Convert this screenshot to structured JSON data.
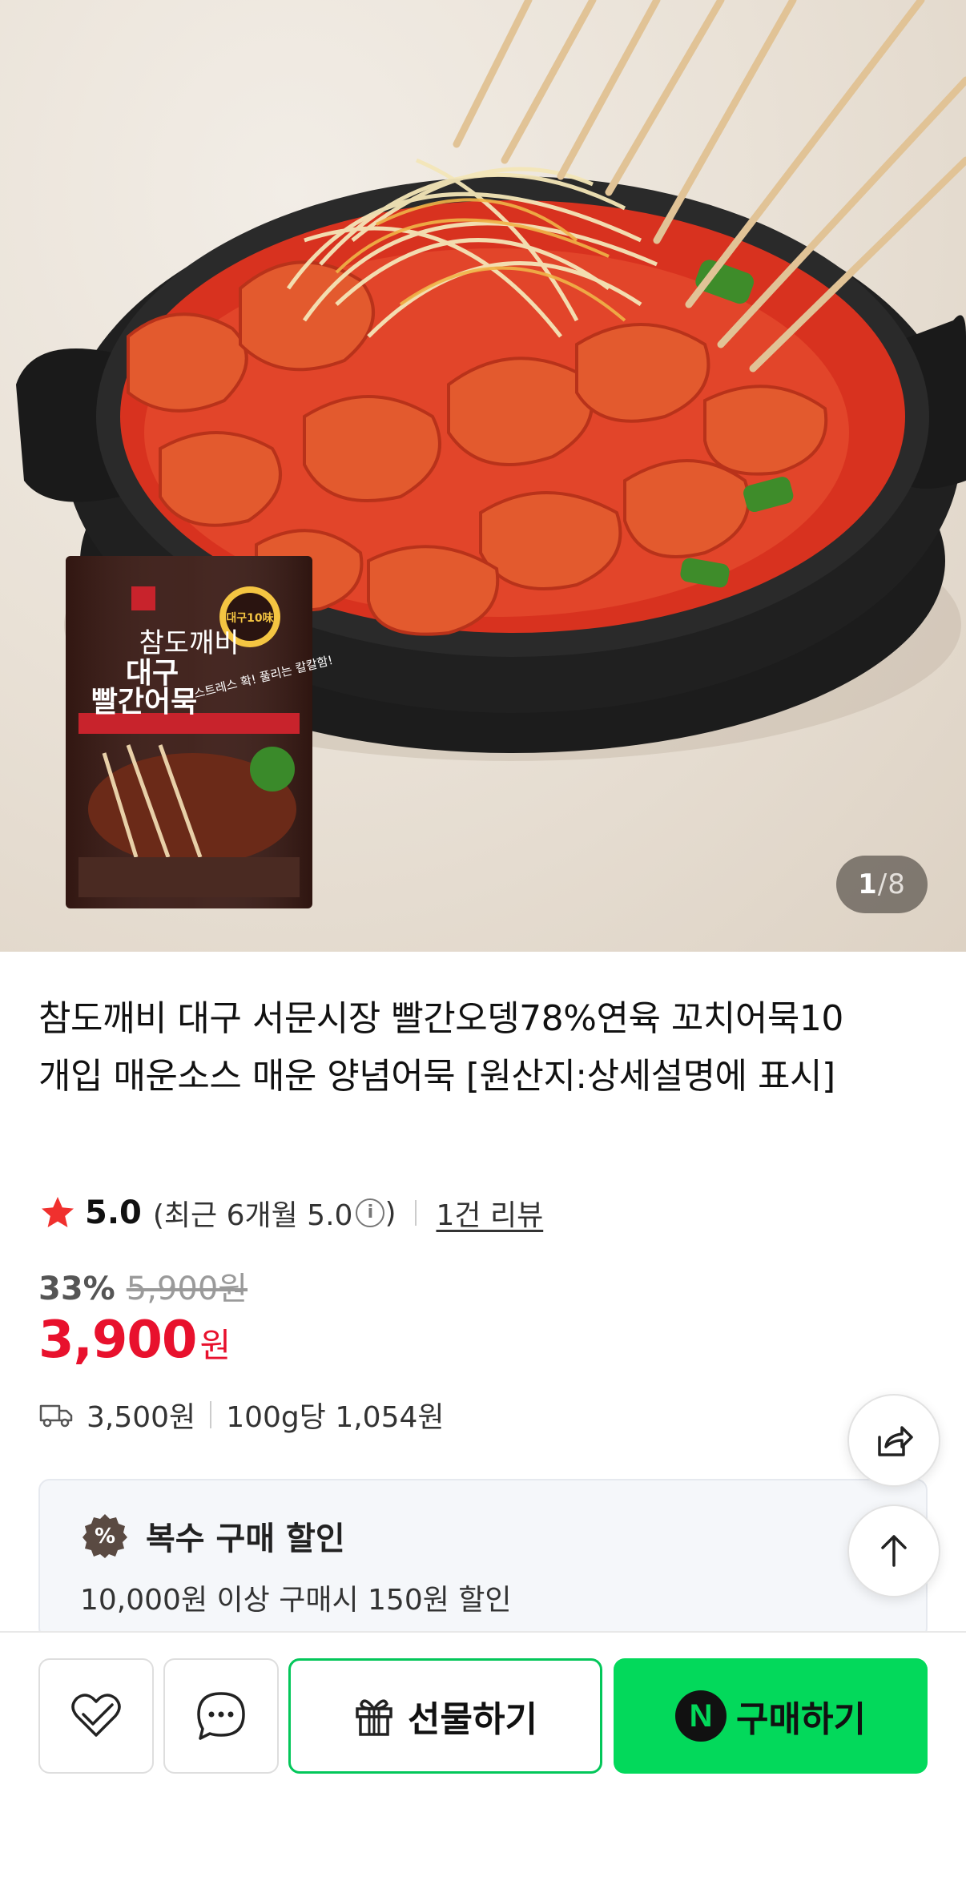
{
  "hero": {
    "image_alt": "빨간어묵 꼬치 요리 사진",
    "package": {
      "brand": "참도깨비",
      "badge": "대구10味",
      "line1": "대구",
      "line2": "빨간어묵",
      "tagline": "스트레스 확! 풀리는 칼칼함!"
    },
    "pager": {
      "current": "1",
      "separator": "/",
      "total": "8"
    }
  },
  "product": {
    "title": "참도깨비 대구 서문시장 빨간오뎅78%연육 꼬치어묵10개입 매운소스 매운 양념어묵 [원산지:상세설명에 표시]",
    "rating": {
      "score": "5.0",
      "recent_label": "(최근 6개월 5.0",
      "recent_close": ")",
      "review_link": "1건 리뷰"
    },
    "discount_rate": "33%",
    "original_price": "5,900원",
    "price": "3,900",
    "price_unit": "원",
    "shipping_fee": "3,500원",
    "unit_price": "100g당 1,054원"
  },
  "promo": {
    "title": "복수 구매 할인",
    "description": "10,000원 이상 구매시 150원 할인"
  },
  "bottom_bar": {
    "gift_label": "선물하기",
    "buy_badge": "N",
    "buy_label": "구매하기"
  },
  "colors": {
    "price_red": "#e8112d",
    "naver_green": "#03d95b",
    "star_red": "#f0302e"
  }
}
